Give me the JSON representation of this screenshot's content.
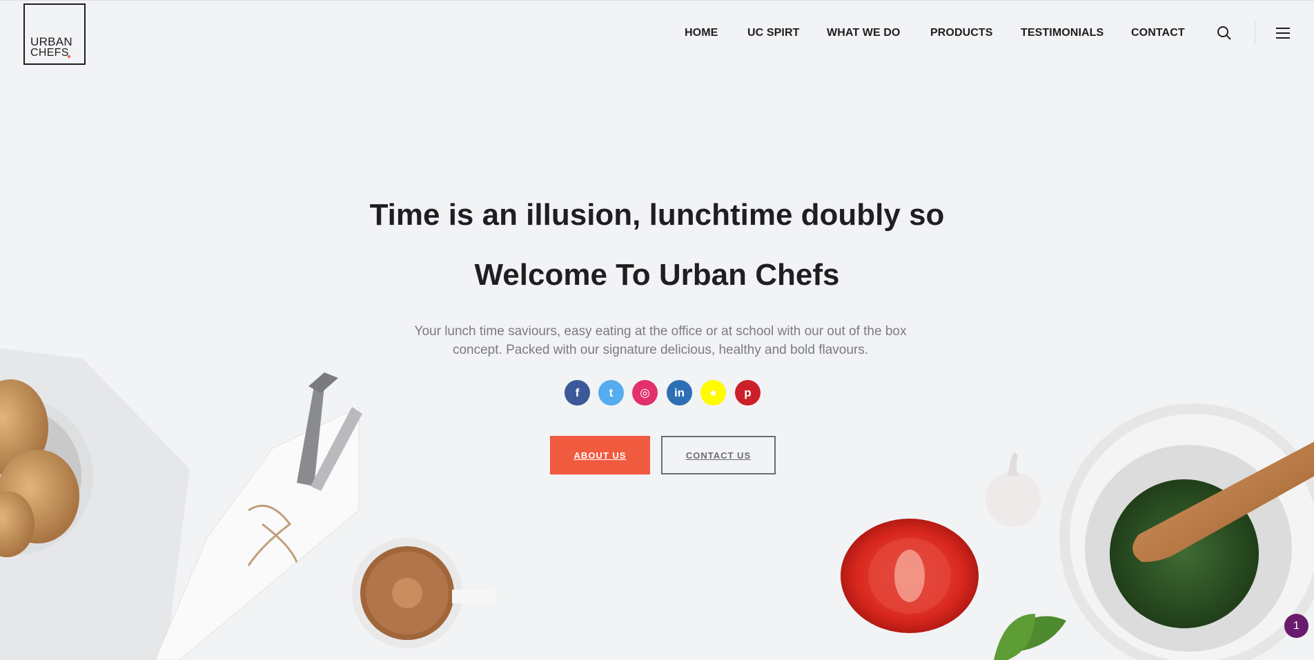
{
  "brand": {
    "line1": "URBAN",
    "line2": "CHEFS"
  },
  "nav": {
    "items": [
      "HOME",
      "UC SPIRT",
      "WHAT WE DO",
      "PRODUCTS",
      "TESTIMONIALS",
      "CONTACT"
    ]
  },
  "icons": {
    "search": "search-icon",
    "menu": "hamburger-menu-icon"
  },
  "hero": {
    "title": "Time is an illusion, lunchtime doubly so",
    "subtitle": "Welcome To Urban Chefs",
    "description": "Your lunch time saviours, easy eating at the office or at school with our out of the box concept. Packed with our signature delicious, healthy and bold flavours."
  },
  "social": [
    {
      "name": "facebook",
      "glyph": "f",
      "color": "#3b5998"
    },
    {
      "name": "twitter",
      "glyph": "t",
      "color": "#55acee"
    },
    {
      "name": "instagram",
      "glyph": "◎",
      "color": "#e1306c"
    },
    {
      "name": "linkedin",
      "glyph": "in",
      "color": "#2d6fb5"
    },
    {
      "name": "snapchat",
      "glyph": "●",
      "color": "#fffc00"
    },
    {
      "name": "pinterest",
      "glyph": "p",
      "color": "#cb2027"
    }
  ],
  "buttons": {
    "about": "ABOUT US",
    "contact": "CONTACT US"
  },
  "chat_badge": {
    "count": "1",
    "color": "#6a1b6e"
  },
  "colors": {
    "accent": "#f05a3f",
    "background": "#f2f3f5",
    "text": "#1f1f22"
  }
}
